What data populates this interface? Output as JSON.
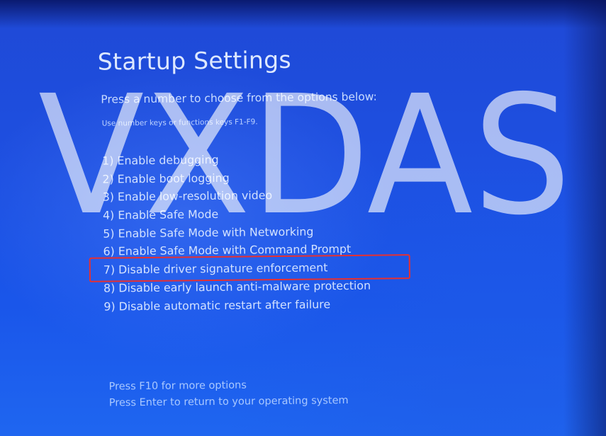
{
  "screen": {
    "title": "Startup Settings",
    "prompt": "Press a number to choose from the options below:",
    "hint": "Use number keys or functions keys F1-F9.",
    "options": [
      "1) Enable debugging",
      "2) Enable boot logging",
      "3) Enable low-resolution video",
      "4) Enable Safe Mode",
      "5) Enable Safe Mode with Networking",
      "6) Enable Safe Mode with Command Prompt",
      "7) Disable driver signature enforcement",
      "8) Disable early launch anti-malware protection",
      "9) Disable automatic restart after failure"
    ],
    "highlighted_option_index": 6,
    "footer": {
      "more_options": "Press F10 for more options",
      "return": "Press Enter to return to your operating system"
    }
  },
  "watermark": {
    "text": "VXDAS"
  },
  "colors": {
    "background": "#1e4fe0",
    "text": "#d3e2ff",
    "highlight_border": "#e83030",
    "watermark": "#ffffff"
  }
}
